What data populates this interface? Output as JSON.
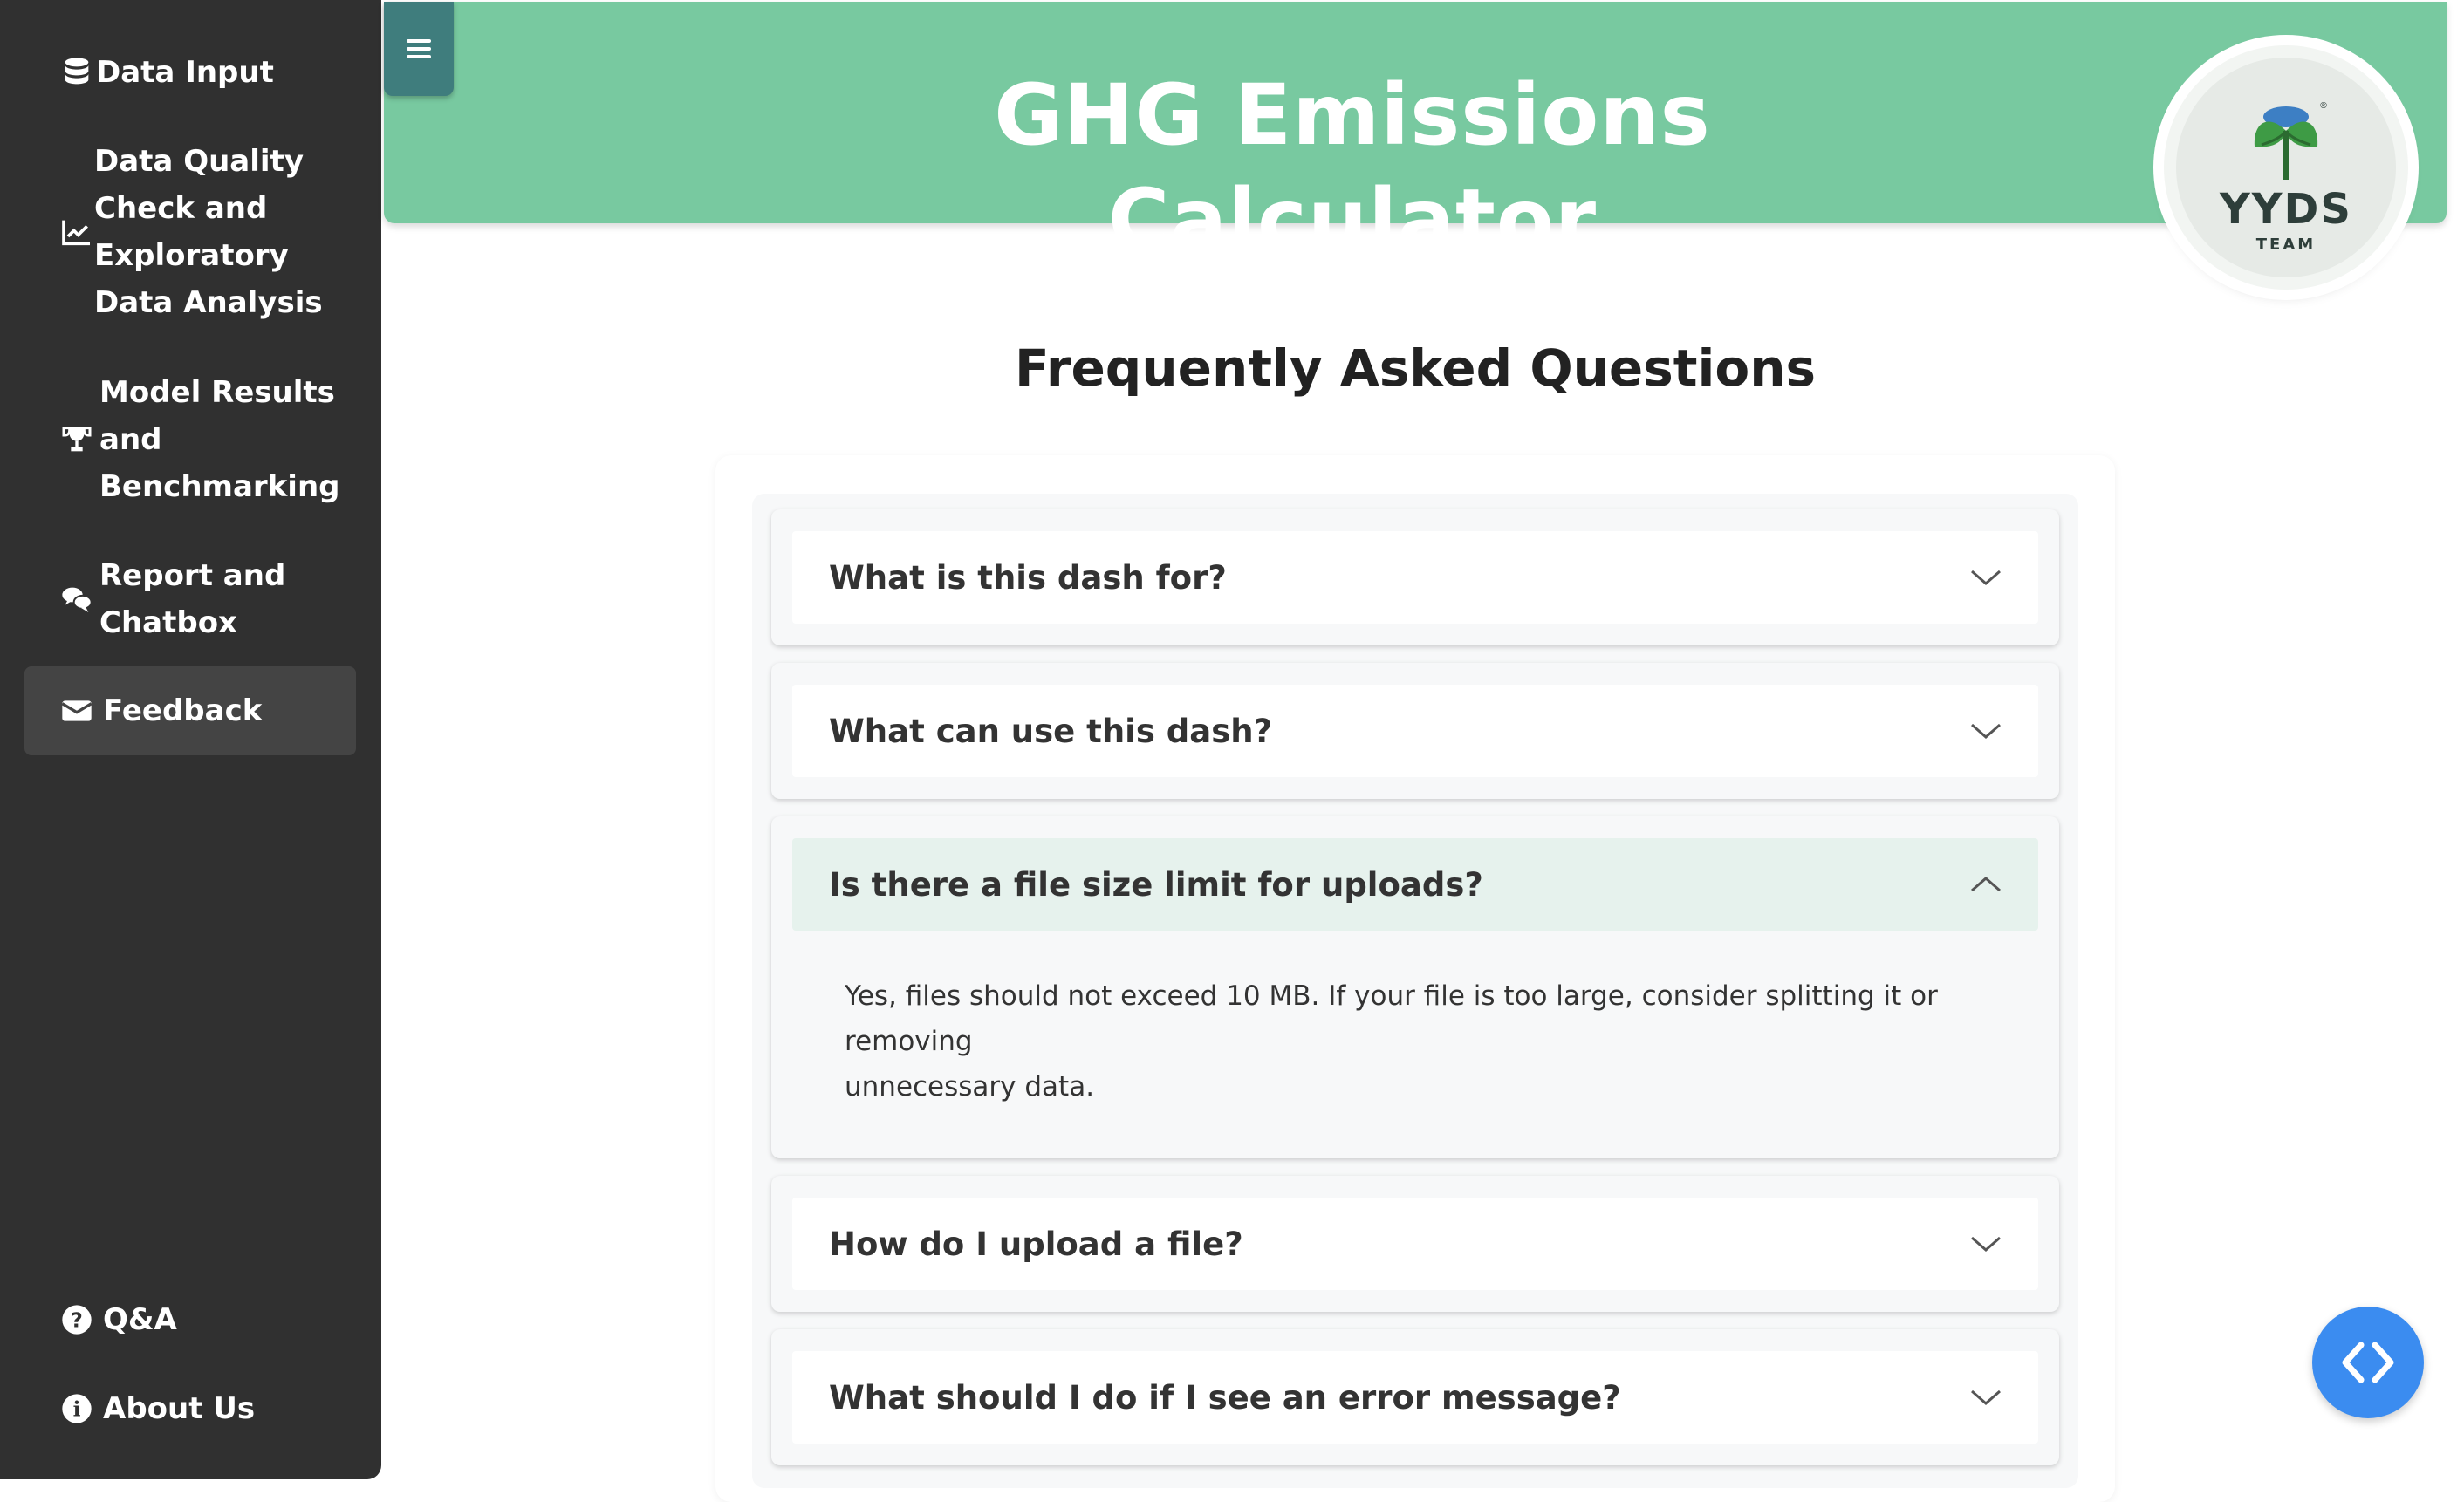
{
  "sidebar": {
    "items": [
      {
        "label": "Data Input",
        "icon": "database-icon"
      },
      {
        "label_lines": [
          "Data Quality",
          "Check and",
          "Exploratory",
          "Data Analysis"
        ],
        "icon": "chart-line-icon"
      },
      {
        "label_lines": [
          "Model Results",
          "and",
          "Benchmarking"
        ],
        "icon": "trophy-icon"
      },
      {
        "label_lines": [
          "Report and",
          "Chatbox"
        ],
        "icon": "comments-icon"
      },
      {
        "label": "Feedback",
        "icon": "envelope-icon",
        "active": true
      }
    ],
    "bottom_items": [
      {
        "label": "Q&A",
        "icon": "question-circle-icon"
      },
      {
        "label": "About Us",
        "icon": "info-circle-icon"
      }
    ]
  },
  "toggle": {
    "icon": "hamburger-icon"
  },
  "header": {
    "title": "GHG Emissions Calculator",
    "logo_text": "YYDS",
    "logo_sub": "TEAM",
    "logo_mark": "®",
    "color": "#78c9a0"
  },
  "faq": {
    "title": "Frequently Asked Questions",
    "items": [
      {
        "question": "What is this dash for?",
        "open": false
      },
      {
        "question": "What can use this dash?",
        "open": false
      },
      {
        "question": "Is there a file size limit for uploads?",
        "open": true,
        "answer_lines": [
          "Yes, files should not exceed 10 MB. If your file is too large, consider splitting it or removing",
          "unnecessary data."
        ]
      },
      {
        "question": "How do I upload a file?",
        "open": false
      },
      {
        "question": "What should I do if I see an error message?",
        "open": false
      }
    ]
  },
  "fab": {
    "icon": "code-arrows-icon",
    "color": "#3b8cf0"
  }
}
